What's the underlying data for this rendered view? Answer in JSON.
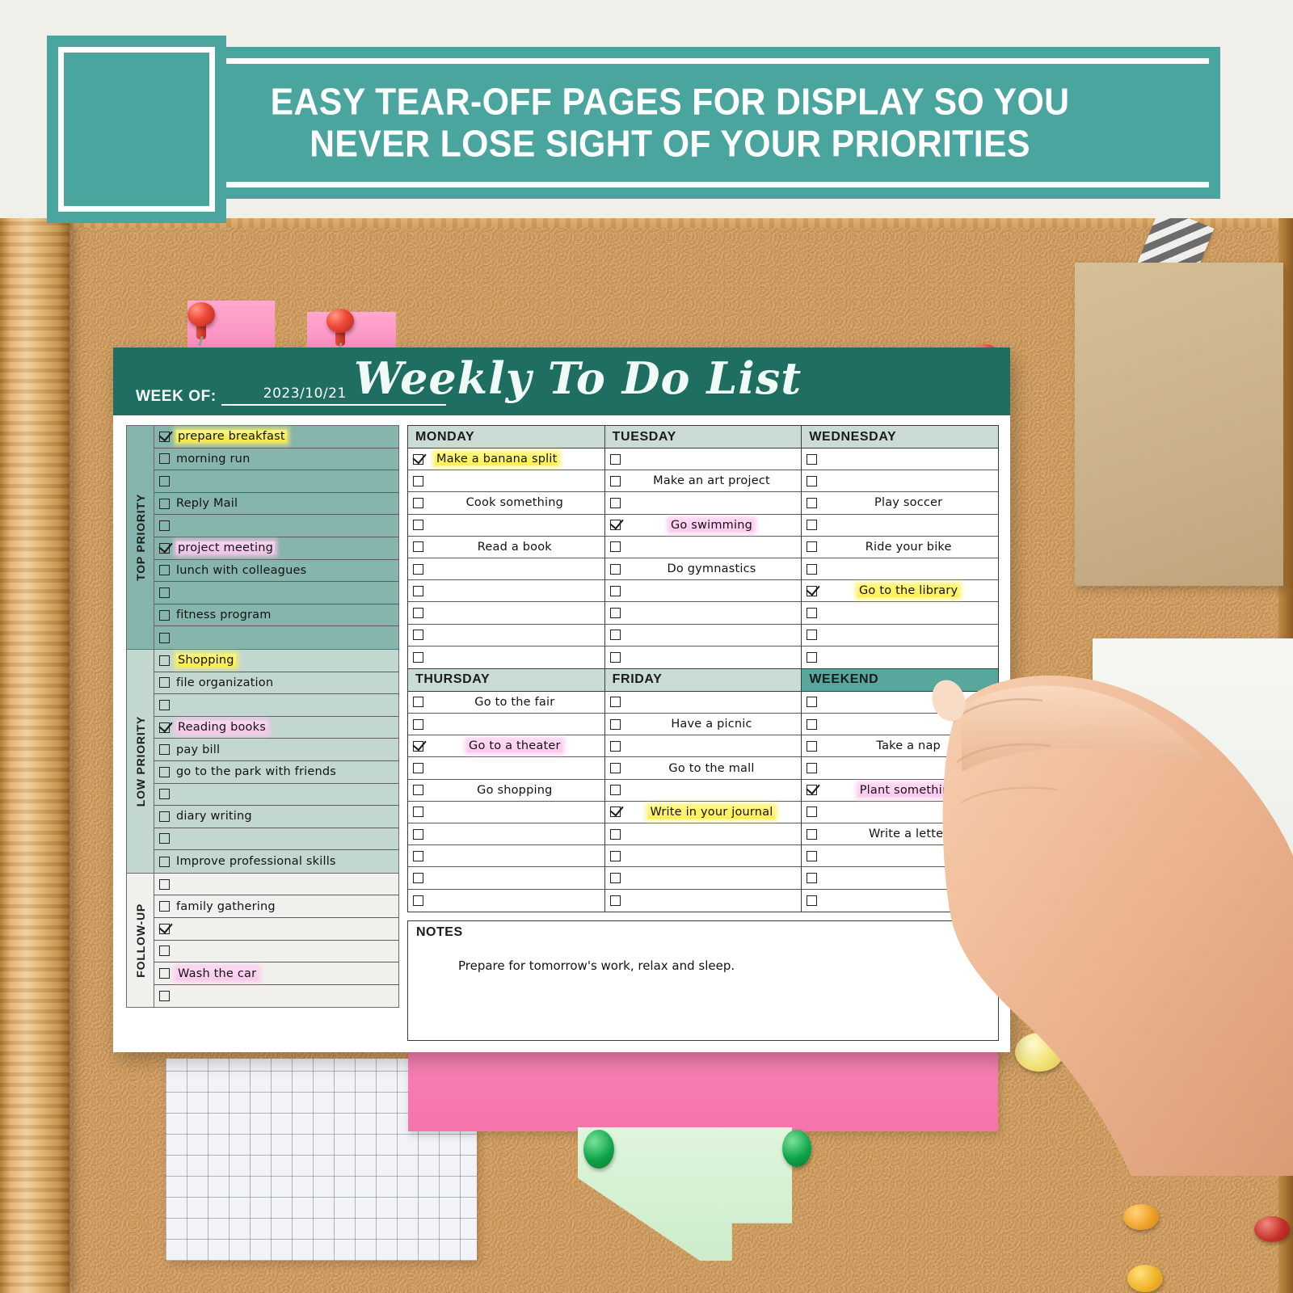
{
  "banner": {
    "headline_line1": "EASY TEAR-OFF PAGES FOR DISPLAY SO YOU",
    "headline_line2": "NEVER LOSE SIGHT OF YOUR PRIORITIES",
    "accent_color": "#4aa59e"
  },
  "planner": {
    "title": "Weekly To Do List",
    "week_of_label": "WEEK OF:",
    "week_of_value": "2023/10/21",
    "header_color": "#1e6f62"
  },
  "priority_sections": [
    {
      "label": "TOP PRIORITY",
      "bg_color": "#85b5ac",
      "rows": [
        {
          "text": "prepare breakfast",
          "checked": true,
          "highlight": "yellow"
        },
        {
          "text": "morning run",
          "checked": false,
          "highlight": "none"
        },
        {
          "text": "",
          "checked": false,
          "highlight": "none"
        },
        {
          "text": "Reply Mail",
          "checked": false,
          "highlight": "none"
        },
        {
          "text": "",
          "checked": false,
          "highlight": "none"
        },
        {
          "text": "project meeting",
          "checked": true,
          "highlight": "pink"
        },
        {
          "text": "lunch with colleagues",
          "checked": false,
          "highlight": "none"
        },
        {
          "text": "",
          "checked": false,
          "highlight": "none"
        },
        {
          "text": "fitness program",
          "checked": false,
          "highlight": "none"
        },
        {
          "text": "",
          "checked": false,
          "highlight": "none"
        }
      ]
    },
    {
      "label": "LOW PRIORITY",
      "bg_color": "#c2d7d0",
      "rows": [
        {
          "text": "Shopping",
          "checked": false,
          "highlight": "yellow"
        },
        {
          "text": "file organization",
          "checked": false,
          "highlight": "none"
        },
        {
          "text": "",
          "checked": false,
          "highlight": "none"
        },
        {
          "text": "Reading books",
          "checked": true,
          "highlight": "pink"
        },
        {
          "text": "pay bill",
          "checked": false,
          "highlight": "none"
        },
        {
          "text": "go to the park with friends",
          "checked": false,
          "highlight": "none"
        },
        {
          "text": "",
          "checked": false,
          "highlight": "none"
        },
        {
          "text": "diary writing",
          "checked": false,
          "highlight": "none"
        },
        {
          "text": "",
          "checked": false,
          "highlight": "none"
        },
        {
          "text": "Improve professional skills",
          "checked": false,
          "highlight": "none"
        }
      ]
    },
    {
      "label": "FOLLOW-UP",
      "bg_color": "#f1f0ec",
      "rows": [
        {
          "text": "",
          "checked": false,
          "highlight": "none"
        },
        {
          "text": "family gathering",
          "checked": false,
          "highlight": "none"
        },
        {
          "text": "",
          "checked": true,
          "highlight": "none"
        },
        {
          "text": "",
          "checked": false,
          "highlight": "none"
        },
        {
          "text": "Wash the car",
          "checked": false,
          "highlight": "pink"
        },
        {
          "text": "",
          "checked": false,
          "highlight": "none"
        }
      ]
    }
  ],
  "day_grids": [
    {
      "columns": [
        {
          "header": "MONDAY",
          "weekend": false,
          "rows": [
            {
              "text": "Make a banana split",
              "checked": true,
              "highlight": "yellow",
              "align": "lead"
            },
            {
              "text": "",
              "checked": false,
              "highlight": "none",
              "align": "center"
            },
            {
              "text": "Cook something",
              "checked": false,
              "highlight": "none",
              "align": "center"
            },
            {
              "text": "",
              "checked": false,
              "highlight": "none",
              "align": "center"
            },
            {
              "text": "Read a book",
              "checked": false,
              "highlight": "none",
              "align": "center"
            },
            {
              "text": "",
              "checked": false,
              "highlight": "none",
              "align": "center"
            },
            {
              "text": "",
              "checked": false,
              "highlight": "none",
              "align": "center"
            },
            {
              "text": "",
              "checked": false,
              "highlight": "none",
              "align": "center"
            },
            {
              "text": "",
              "checked": false,
              "highlight": "none",
              "align": "center"
            },
            {
              "text": "",
              "checked": false,
              "highlight": "none",
              "align": "center"
            }
          ]
        },
        {
          "header": "TUESDAY",
          "weekend": false,
          "rows": [
            {
              "text": "",
              "checked": false,
              "highlight": "none",
              "align": "center"
            },
            {
              "text": "Make an art project",
              "checked": false,
              "highlight": "none",
              "align": "center"
            },
            {
              "text": "",
              "checked": false,
              "highlight": "none",
              "align": "center"
            },
            {
              "text": "Go swimming",
              "checked": true,
              "highlight": "pink",
              "align": "center"
            },
            {
              "text": "",
              "checked": false,
              "highlight": "none",
              "align": "center"
            },
            {
              "text": "Do gymnastics",
              "checked": false,
              "highlight": "none",
              "align": "center"
            },
            {
              "text": "",
              "checked": false,
              "highlight": "none",
              "align": "center"
            },
            {
              "text": "",
              "checked": false,
              "highlight": "none",
              "align": "center"
            },
            {
              "text": "",
              "checked": false,
              "highlight": "none",
              "align": "center"
            },
            {
              "text": "",
              "checked": false,
              "highlight": "none",
              "align": "center"
            }
          ]
        },
        {
          "header": "WEDNESDAY",
          "weekend": false,
          "rows": [
            {
              "text": "",
              "checked": false,
              "highlight": "none",
              "align": "center"
            },
            {
              "text": "",
              "checked": false,
              "highlight": "none",
              "align": "center"
            },
            {
              "text": "Play soccer",
              "checked": false,
              "highlight": "none",
              "align": "center"
            },
            {
              "text": "",
              "checked": false,
              "highlight": "none",
              "align": "center"
            },
            {
              "text": "Ride your bike",
              "checked": false,
              "highlight": "none",
              "align": "center"
            },
            {
              "text": "",
              "checked": false,
              "highlight": "none",
              "align": "center"
            },
            {
              "text": "Go to the library",
              "checked": true,
              "highlight": "yellow",
              "align": "center"
            },
            {
              "text": "",
              "checked": false,
              "highlight": "none",
              "align": "center"
            },
            {
              "text": "",
              "checked": false,
              "highlight": "none",
              "align": "center"
            },
            {
              "text": "",
              "checked": false,
              "highlight": "none",
              "align": "center"
            }
          ]
        }
      ]
    },
    {
      "columns": [
        {
          "header": "THURSDAY",
          "weekend": false,
          "rows": [
            {
              "text": "Go to the fair",
              "checked": false,
              "highlight": "none",
              "align": "center"
            },
            {
              "text": "",
              "checked": false,
              "highlight": "none",
              "align": "center"
            },
            {
              "text": "Go to a theater",
              "checked": true,
              "highlight": "pink",
              "align": "center"
            },
            {
              "text": "",
              "checked": false,
              "highlight": "none",
              "align": "center"
            },
            {
              "text": "Go shopping",
              "checked": false,
              "highlight": "none",
              "align": "center"
            },
            {
              "text": "",
              "checked": false,
              "highlight": "none",
              "align": "center"
            },
            {
              "text": "",
              "checked": false,
              "highlight": "none",
              "align": "center"
            },
            {
              "text": "",
              "checked": false,
              "highlight": "none",
              "align": "center"
            },
            {
              "text": "",
              "checked": false,
              "highlight": "none",
              "align": "center"
            },
            {
              "text": "",
              "checked": false,
              "highlight": "none",
              "align": "center"
            }
          ]
        },
        {
          "header": "FRIDAY",
          "weekend": false,
          "rows": [
            {
              "text": "",
              "checked": false,
              "highlight": "none",
              "align": "center"
            },
            {
              "text": "Have a picnic",
              "checked": false,
              "highlight": "none",
              "align": "center"
            },
            {
              "text": "",
              "checked": false,
              "highlight": "none",
              "align": "center"
            },
            {
              "text": "Go to the mall",
              "checked": false,
              "highlight": "none",
              "align": "center"
            },
            {
              "text": "",
              "checked": false,
              "highlight": "none",
              "align": "center"
            },
            {
              "text": "Write in your journal",
              "checked": true,
              "highlight": "yellow",
              "align": "center"
            },
            {
              "text": "",
              "checked": false,
              "highlight": "none",
              "align": "center"
            },
            {
              "text": "",
              "checked": false,
              "highlight": "none",
              "align": "center"
            },
            {
              "text": "",
              "checked": false,
              "highlight": "none",
              "align": "center"
            },
            {
              "text": "",
              "checked": false,
              "highlight": "none",
              "align": "center"
            }
          ]
        },
        {
          "header": "WEEKEND",
          "weekend": true,
          "rows": [
            {
              "text": "",
              "checked": false,
              "highlight": "none",
              "align": "center"
            },
            {
              "text": "",
              "checked": false,
              "highlight": "none",
              "align": "center"
            },
            {
              "text": "Take a nap",
              "checked": false,
              "highlight": "none",
              "align": "center"
            },
            {
              "text": "",
              "checked": false,
              "highlight": "none",
              "align": "center"
            },
            {
              "text": "Plant something",
              "checked": true,
              "highlight": "pink",
              "align": "center"
            },
            {
              "text": "",
              "checked": false,
              "highlight": "none",
              "align": "center"
            },
            {
              "text": "Write a letter",
              "checked": false,
              "highlight": "none",
              "align": "center"
            },
            {
              "text": "",
              "checked": false,
              "highlight": "none",
              "align": "center"
            },
            {
              "text": "",
              "checked": false,
              "highlight": "none",
              "align": "center"
            },
            {
              "text": "",
              "checked": false,
              "highlight": "none",
              "align": "center"
            }
          ]
        }
      ]
    }
  ],
  "notes": {
    "label": "NOTES",
    "text": "Prepare for tomorrow's work, relax and sleep."
  }
}
